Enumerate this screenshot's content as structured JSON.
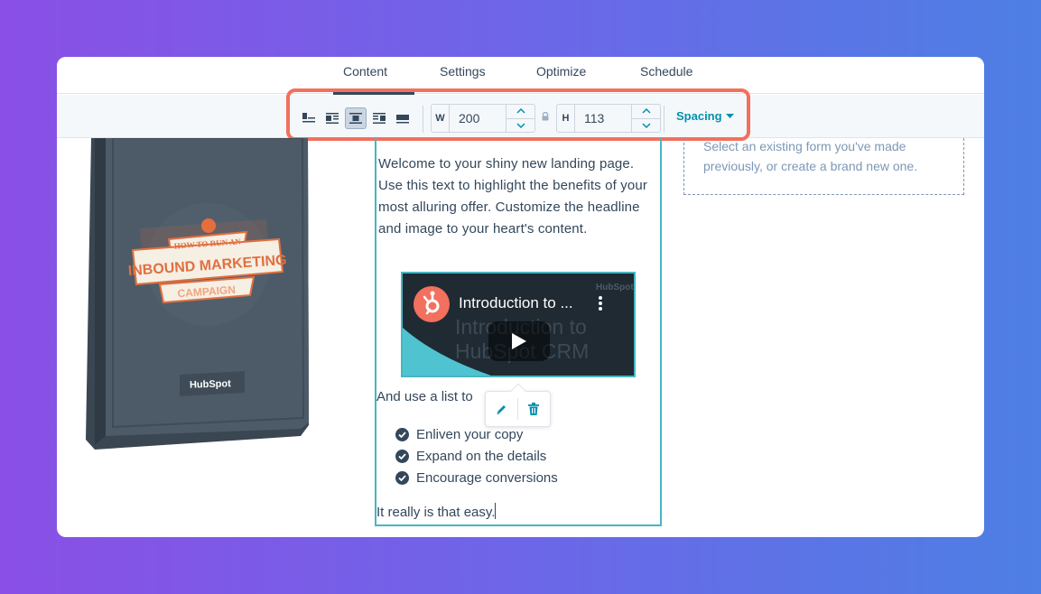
{
  "tabs": [
    {
      "label": "Content",
      "active": true
    },
    {
      "label": "Settings",
      "active": false
    },
    {
      "label": "Optimize",
      "active": false
    },
    {
      "label": "Schedule",
      "active": false
    }
  ],
  "toolbar": {
    "alignment_options": [
      "align-left-wrap",
      "float-left",
      "center",
      "float-right",
      "full-width"
    ],
    "selected_alignment": "center",
    "width": {
      "label": "W",
      "value": "200"
    },
    "height": {
      "label": "H",
      "value": "113"
    },
    "spacing_label": "Spacing",
    "accent_color": "#0091ae",
    "highlight_color": "#f2705e"
  },
  "ebook": {
    "tagline": "HOW TO RUN AN",
    "title": "INBOUND MARKETING",
    "subtitle": "CAMPAIGN",
    "brand": "HubSpot"
  },
  "form_placeholder": {
    "text": "Select an existing form you've made previously, or create a brand new one."
  },
  "content": {
    "intro": "Welcome to your shiny new landing page. Use this text to highlight the benefits of your most alluring offer. Customize the headline and image to your heart's content.",
    "list_intro": "And use a list to",
    "list_items": [
      "Enliven your copy",
      "Expand on the details",
      "Encourage conversions"
    ],
    "closing": "It really is that easy."
  },
  "video": {
    "title": "Introduction to ...",
    "slide_line1": "Introduction to",
    "slide_line2": "HubSpot CRM",
    "watermark": "HubSpot"
  },
  "popover": {
    "edit_icon": "pencil-icon",
    "delete_icon": "trash-icon"
  }
}
